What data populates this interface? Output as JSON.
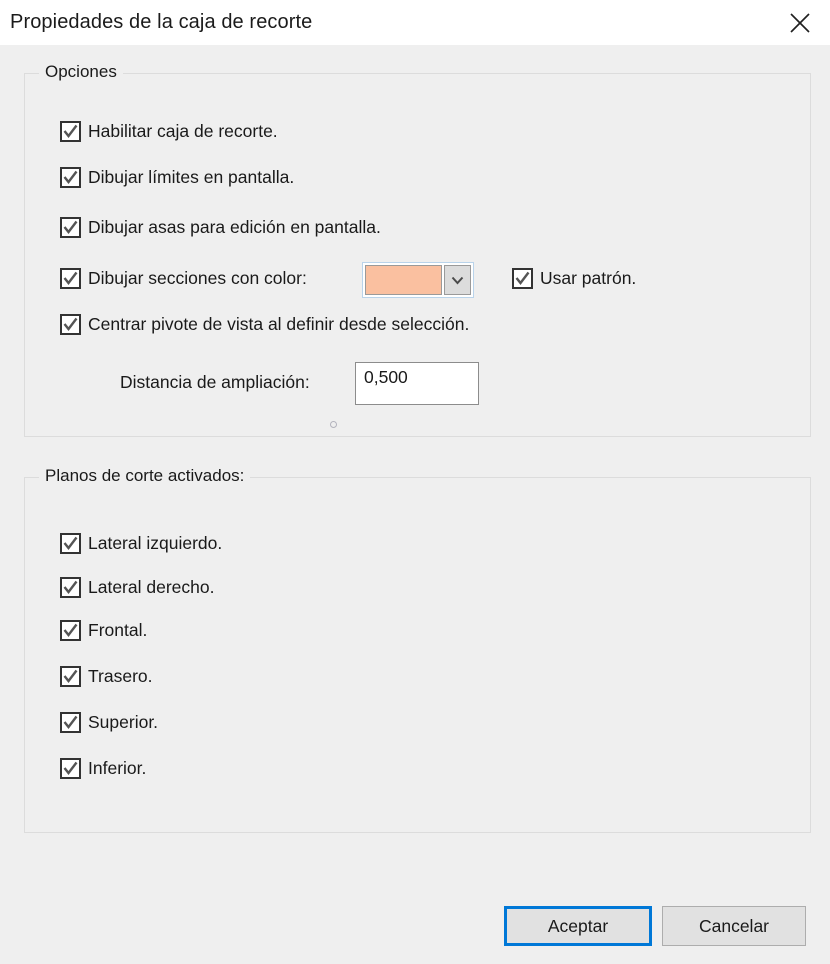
{
  "window": {
    "title": "Propiedades de la caja de recorte",
    "close_icon": "close-icon"
  },
  "options_group": {
    "title": "Opciones",
    "checkboxes": [
      {
        "label": "Habilitar caja de recorte.",
        "checked": true
      },
      {
        "label": "Dibujar límites en pantalla.",
        "checked": true
      },
      {
        "label": "Dibujar asas para edición en pantalla.",
        "checked": true
      },
      {
        "label": "Dibujar secciones con color:",
        "checked": true
      },
      {
        "label": "Usar patrón.",
        "checked": true
      },
      {
        "label": "Centrar pivote de vista al definir desde selección.",
        "checked": true
      }
    ],
    "color_picker": {
      "swatch_color": "#fac0a0",
      "dropdown_icon": "chevron-down-icon"
    },
    "distance_field": {
      "label": "Distancia de ampliación:",
      "value": "0,500"
    }
  },
  "planes_group": {
    "title": "Planos de corte activados:",
    "checkboxes": [
      {
        "label": "Lateral izquierdo.",
        "checked": true
      },
      {
        "label": "Lateral derecho.",
        "checked": true
      },
      {
        "label": "Frontal.",
        "checked": true
      },
      {
        "label": "Trasero.",
        "checked": true
      },
      {
        "label": "Superior.",
        "checked": true
      },
      {
        "label": "Inferior.",
        "checked": true
      }
    ]
  },
  "buttons": {
    "accept": "Aceptar",
    "cancel": "Cancelar"
  },
  "colors": {
    "accent": "#0078d7",
    "dialog_background": "#efefef",
    "titlebar_background": "#ffffff",
    "groupbox_border": "#dcdcdc"
  }
}
